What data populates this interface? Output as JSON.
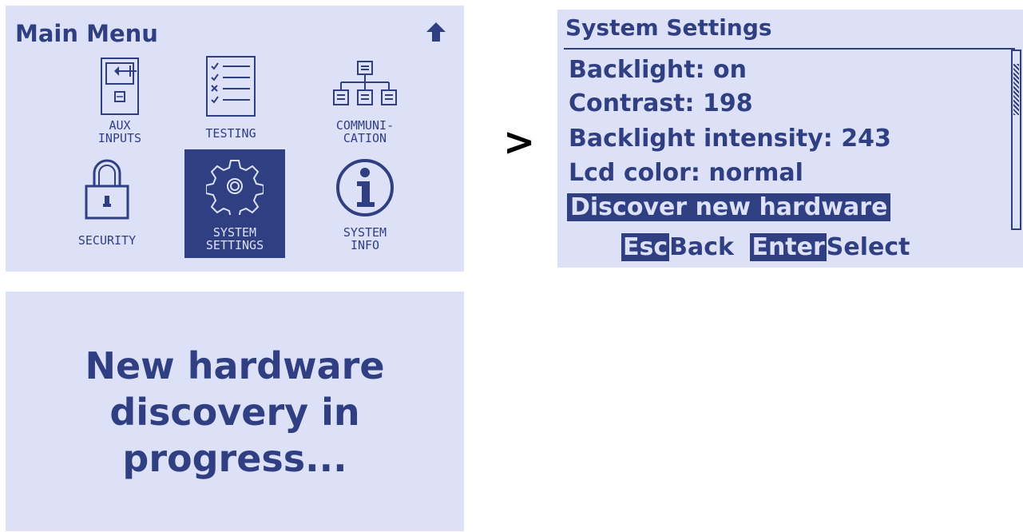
{
  "main_menu": {
    "title": "Main Menu",
    "icons": {
      "up": "up-arrow-icon"
    },
    "tiles": [
      {
        "line1": "AUX",
        "line2": "INPUTS",
        "icon": "aux-input-icon"
      },
      {
        "line1": "TESTING",
        "line2": "",
        "icon": "checklist-icon"
      },
      {
        "line1": "COMMUNI-",
        "line2": "CATION",
        "icon": "network-tree-icon"
      },
      {
        "line1": "SECURITY",
        "line2": "",
        "icon": "padlock-icon"
      },
      {
        "line1": "SYSTEM",
        "line2": "SETTINGS",
        "icon": "gear-icon",
        "selected": true
      },
      {
        "line1": "SYSTEM",
        "line2": "INFO",
        "icon": "info-icon"
      }
    ]
  },
  "arrow": ">",
  "system_settings": {
    "title": "System Settings",
    "items": [
      "Backlight: on",
      "Contrast: 198",
      "Backlight intensity: 243",
      "Lcd color: normal",
      "Discover new hardware"
    ],
    "selected_index": 4,
    "footer": {
      "esc_key": "Esc",
      "esc_label": "Back",
      "enter_key": "Enter",
      "enter_label": "Select"
    }
  },
  "discovery": {
    "line1": "New hardware",
    "line2": "discovery in",
    "line3": "progress..."
  },
  "colors": {
    "lcd_background": "#dde1f8",
    "lcd_ink": "#2f3f82"
  }
}
